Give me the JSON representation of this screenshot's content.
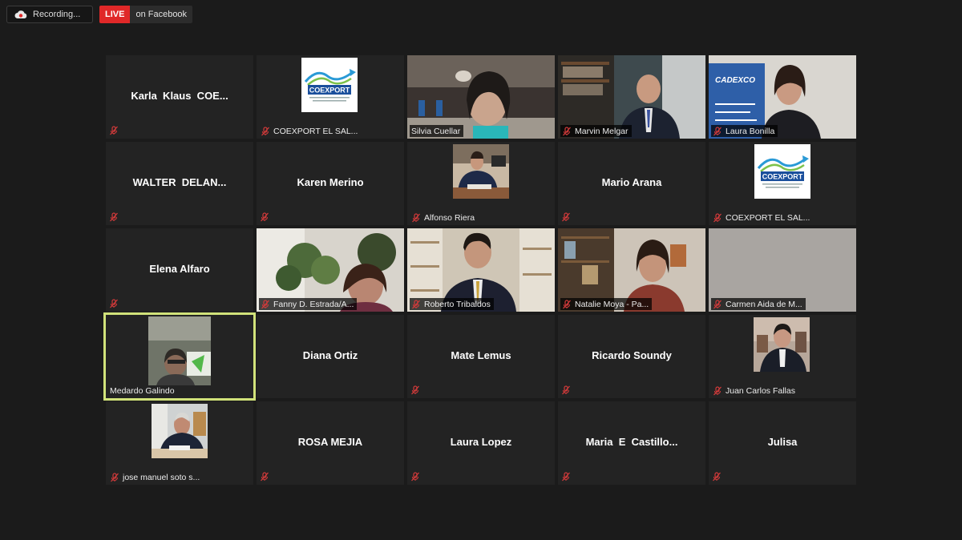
{
  "recording": {
    "label": "Recording...",
    "icon": "cloud-record-icon"
  },
  "live": {
    "badge": "LIVE",
    "text": "on Facebook"
  },
  "colors": {
    "background": "#1b1b1b",
    "tile": "#232323",
    "live_red": "#e02828",
    "active_speaker": "#d1e27a",
    "muted_mic": "#d13a3a"
  },
  "participants": [
    {
      "name": "Karla  Klaus  COE...",
      "muted": true
    },
    {
      "name": "COEXPORT EL SAL...",
      "muted": true,
      "logo": "COEXPORT"
    },
    {
      "name": "Silvia Cuellar",
      "muted": false
    },
    {
      "name": "Marvin Melgar",
      "muted": true
    },
    {
      "name": "Laura Bonilla",
      "muted": true,
      "logo": "CADEXCO"
    },
    {
      "name": "WALTER  DELAN...",
      "muted": true
    },
    {
      "name": "Karen Merino",
      "muted": true
    },
    {
      "name": "Alfonso Riera",
      "muted": true
    },
    {
      "name": "Mario Arana",
      "muted": true
    },
    {
      "name": "COEXPORT EL SAL...",
      "muted": true,
      "logo": "COEXPORT"
    },
    {
      "name": "Elena Alfaro",
      "muted": true
    },
    {
      "name": "Fanny D. Estrada/A...",
      "muted": true
    },
    {
      "name": "Roberto Tribaldos",
      "muted": true
    },
    {
      "name": "Natalie Moya - Pa...",
      "muted": true
    },
    {
      "name": "Carmen Aida de M...",
      "muted": true
    },
    {
      "name": "Medardo Galindo",
      "muted": false,
      "active_speaker": true
    },
    {
      "name": "Diana Ortiz",
      "muted": false
    },
    {
      "name": "Mate Lemus",
      "muted": true
    },
    {
      "name": "Ricardo Soundy",
      "muted": true
    },
    {
      "name": "Juan Carlos Fallas",
      "muted": true
    },
    {
      "name": "jose manuel soto s...",
      "muted": true
    },
    {
      "name": "ROSA MEJIA",
      "muted": true
    },
    {
      "name": "Laura Lopez",
      "muted": true
    },
    {
      "name": "Maria  E  Castillo...",
      "muted": true
    },
    {
      "name": "Julisa",
      "muted": true
    }
  ]
}
